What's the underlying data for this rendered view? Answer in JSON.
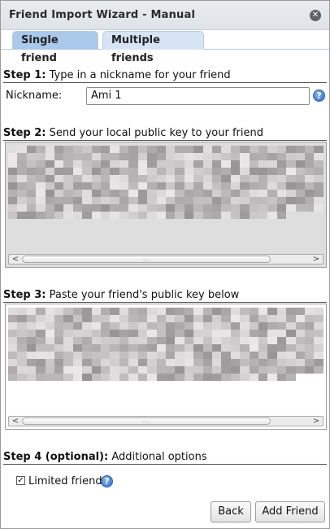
{
  "window": {
    "title": "Friend Import Wizard - Manual",
    "close_glyph": "✕"
  },
  "tabs": [
    {
      "label": "Single friend",
      "active": true
    },
    {
      "label": "Multiple friends",
      "active": false
    }
  ],
  "step1": {
    "prefix": "Step 1:",
    "text": " Type in a nickname for your friend",
    "field_label": "Nickname:",
    "nickname_value": "Ami 1",
    "help_glyph": "?"
  },
  "step2": {
    "prefix": "Step 2:",
    "text": " Send your local public key to your friend"
  },
  "step3": {
    "prefix": "Step 3:",
    "text": " Paste your friend's public key below"
  },
  "step4": {
    "prefix": "Step 4 (optional):",
    "text": " Additional options",
    "limited_label": "Limited friend",
    "limited_checked": true,
    "check_glyph": "✓",
    "help_glyph": "?"
  },
  "scrollbar": {
    "left_arrow": "<",
    "right_arrow": ">",
    "grip": ":::"
  },
  "buttons": {
    "back": "Back",
    "add_friend": "Add Friend"
  },
  "colors": {
    "tab_active": "#a9c8ea",
    "tab_inactive": "#d6e4f3",
    "help_icon": "#2f6cc3"
  }
}
